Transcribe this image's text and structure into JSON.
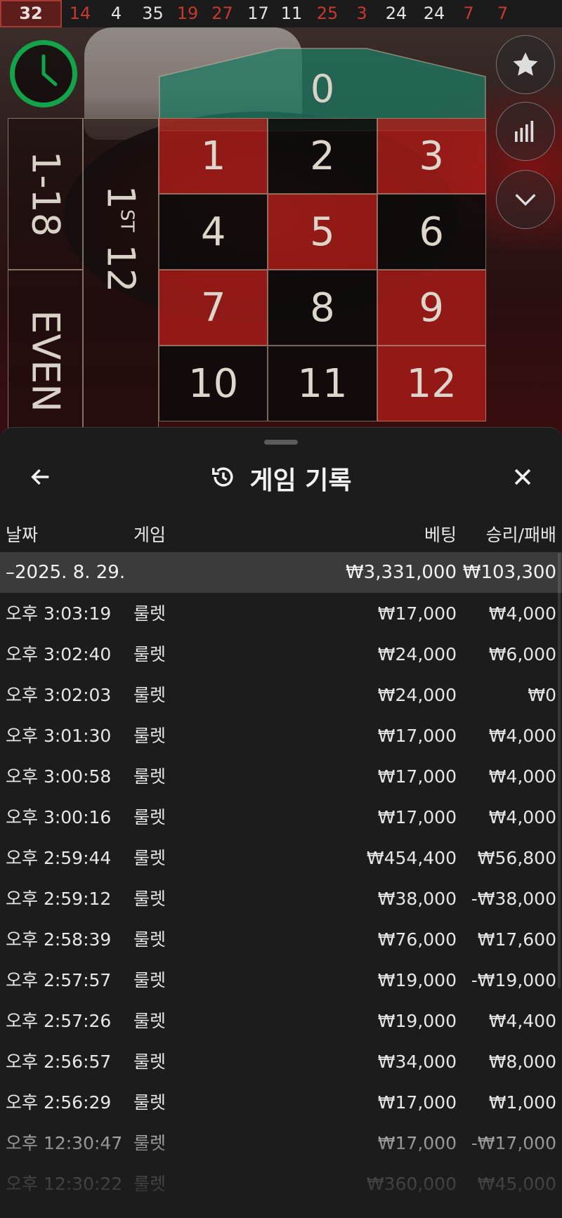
{
  "results": [
    {
      "n": "32",
      "color": "red"
    },
    {
      "n": "14",
      "color": "red"
    },
    {
      "n": "4",
      "color": "black"
    },
    {
      "n": "35",
      "color": "black"
    },
    {
      "n": "19",
      "color": "red"
    },
    {
      "n": "27",
      "color": "red"
    },
    {
      "n": "17",
      "color": "black"
    },
    {
      "n": "11",
      "color": "black"
    },
    {
      "n": "25",
      "color": "red"
    },
    {
      "n": "3",
      "color": "red"
    },
    {
      "n": "24",
      "color": "black"
    },
    {
      "n": "24",
      "color": "black"
    },
    {
      "n": "7",
      "color": "red"
    },
    {
      "n": "7",
      "color": "red"
    }
  ],
  "table": {
    "zero": "0",
    "low": "1-18",
    "even": "EVEN",
    "dozen_num": "1",
    "dozen_sup": "ST",
    "dozen_rest": " 12",
    "numbers": [
      {
        "n": "1",
        "color": "red"
      },
      {
        "n": "2",
        "color": "black"
      },
      {
        "n": "3",
        "color": "red"
      },
      {
        "n": "4",
        "color": "black"
      },
      {
        "n": "5",
        "color": "red"
      },
      {
        "n": "6",
        "color": "black"
      },
      {
        "n": "7",
        "color": "red"
      },
      {
        "n": "8",
        "color": "black"
      },
      {
        "n": "9",
        "color": "red"
      },
      {
        "n": "10",
        "color": "black"
      },
      {
        "n": "11",
        "color": "black"
      },
      {
        "n": "12",
        "color": "red"
      }
    ]
  },
  "side_buttons": [
    "star-icon",
    "statistics-icon",
    "chevron-down-icon"
  ],
  "colors": {
    "red": "#aa1c18",
    "green_zero": "#1f7a63",
    "timer": "#13a34a",
    "sheet_bg": "#1c1c1c"
  },
  "sheet": {
    "title": "게임 기록",
    "headers": {
      "date": "날짜",
      "game": "게임",
      "bet": "베팅",
      "win": "승리/패배"
    },
    "date_row": {
      "date": "–2025. 8. 29.",
      "bet": "₩3,331,000",
      "win": "₩103,300"
    },
    "rows": [
      {
        "time": "오후 3:03:19",
        "game": "룰렛",
        "bet": "₩17,000",
        "win": "₩4,000"
      },
      {
        "time": "오후 3:02:40",
        "game": "룰렛",
        "bet": "₩24,000",
        "win": "₩6,000"
      },
      {
        "time": "오후 3:02:03",
        "game": "룰렛",
        "bet": "₩24,000",
        "win": "₩0"
      },
      {
        "time": "오후 3:01:30",
        "game": "룰렛",
        "bet": "₩17,000",
        "win": "₩4,000"
      },
      {
        "time": "오후 3:00:58",
        "game": "룰렛",
        "bet": "₩17,000",
        "win": "₩4,000"
      },
      {
        "time": "오후 3:00:16",
        "game": "룰렛",
        "bet": "₩17,000",
        "win": "₩4,000"
      },
      {
        "time": "오후 2:59:44",
        "game": "룰렛",
        "bet": "₩454,400",
        "win": "₩56,800"
      },
      {
        "time": "오후 2:59:12",
        "game": "룰렛",
        "bet": "₩38,000",
        "win": "-₩38,000"
      },
      {
        "time": "오후 2:58:39",
        "game": "룰렛",
        "bet": "₩76,000",
        "win": "₩17,600"
      },
      {
        "time": "오후 2:57:57",
        "game": "룰렛",
        "bet": "₩19,000",
        "win": "-₩19,000"
      },
      {
        "time": "오후 2:57:26",
        "game": "룰렛",
        "bet": "₩19,000",
        "win": "₩4,400"
      },
      {
        "time": "오후 2:56:57",
        "game": "룰렛",
        "bet": "₩34,000",
        "win": "₩8,000"
      },
      {
        "time": "오후 2:56:29",
        "game": "룰렛",
        "bet": "₩17,000",
        "win": "₩1,000"
      },
      {
        "time": "오후 12:30:47",
        "game": "룰렛",
        "bet": "₩17,000",
        "win": "-₩17,000"
      },
      {
        "time": "오후 12:30:22",
        "game": "룰렛",
        "bet": "₩360,000",
        "win": "₩45,000"
      }
    ]
  }
}
